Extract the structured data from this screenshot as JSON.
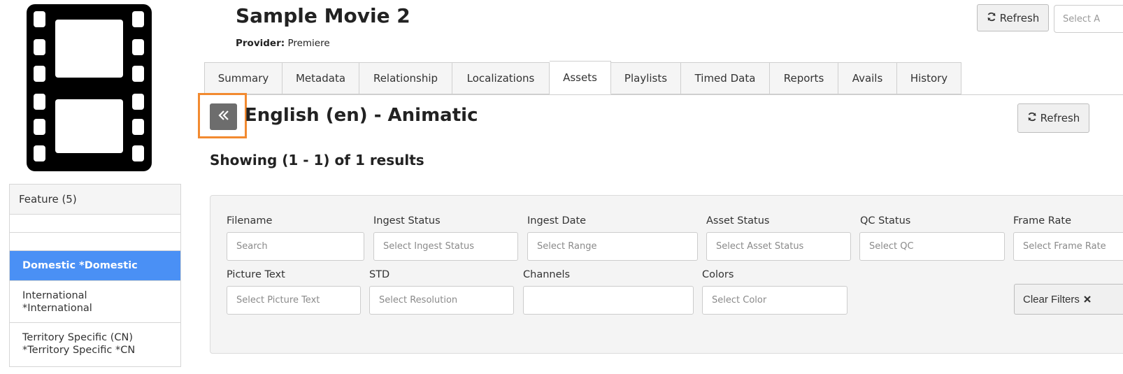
{
  "poster": {
    "icon": "film-strip-icon"
  },
  "sidebar": {
    "header": "Feature (5)",
    "items": [
      {
        "label": "Domestic *Domestic",
        "active": true
      },
      {
        "line1": "International",
        "line2": "*International"
      },
      {
        "line1": "Territory Specific (CN)",
        "line2": "*Territory Specific *CN"
      }
    ]
  },
  "header": {
    "title": "Sample Movie 2",
    "provider_label": "Provider:",
    "provider_value": "Premiere",
    "refresh_label": "Refresh",
    "select_placeholder": "Select A"
  },
  "tabs": [
    {
      "label": "Summary"
    },
    {
      "label": "Metadata"
    },
    {
      "label": "Relationship"
    },
    {
      "label": "Localizations"
    },
    {
      "label": "Assets",
      "active": true
    },
    {
      "label": "Playlists"
    },
    {
      "label": "Timed Data"
    },
    {
      "label": "Reports"
    },
    {
      "label": "Avails"
    },
    {
      "label": "History"
    }
  ],
  "assets": {
    "title": "English (en) - Animatic",
    "refresh_label": "Refresh",
    "showing": "Showing (1 - 1) of 1 results"
  },
  "filters": {
    "filename": {
      "label": "Filename",
      "placeholder": "Search"
    },
    "ingest_status": {
      "label": "Ingest Status",
      "placeholder": "Select Ingest Status"
    },
    "ingest_date": {
      "label": "Ingest Date",
      "placeholder": "Select Range"
    },
    "asset_status": {
      "label": "Asset Status",
      "placeholder": "Select Asset Status"
    },
    "qc_status": {
      "label": "QC Status",
      "placeholder": "Select QC"
    },
    "frame_rate": {
      "label": "Frame Rate",
      "placeholder": "Select Frame Rate"
    },
    "picture_text": {
      "label": "Picture Text",
      "placeholder": "Select Picture Text"
    },
    "std": {
      "label": "STD",
      "placeholder": "Select Resolution"
    },
    "channels": {
      "label": "Channels",
      "placeholder": ""
    },
    "colors": {
      "label": "Colors",
      "placeholder": "Select Color"
    },
    "clear_label": "Clear Filters"
  },
  "colors": {
    "accent": "#4a90f5",
    "highlight": "#f28a30",
    "back_button": "#6d6d6d"
  }
}
